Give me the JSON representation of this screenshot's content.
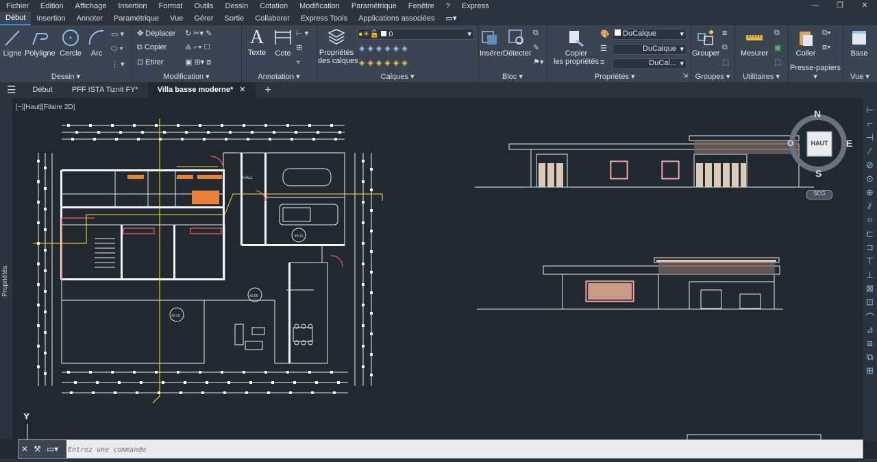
{
  "menu": [
    "Fichier",
    "Edition",
    "Affichage",
    "Insertion",
    "Format",
    "Outils",
    "Dessin",
    "Cotation",
    "Modification",
    "Paramétrique",
    "Fenêtre",
    "?",
    "Express"
  ],
  "ribbon_tabs": [
    {
      "label": "Début",
      "active": true
    },
    {
      "label": "Insertion"
    },
    {
      "label": "Annoter"
    },
    {
      "label": "Paramétrique"
    },
    {
      "label": "Vue"
    },
    {
      "label": "Gérer"
    },
    {
      "label": "Sortie"
    },
    {
      "label": "Collaborer"
    },
    {
      "label": "Express Tools"
    },
    {
      "label": "Applications associées"
    }
  ],
  "panels": {
    "dessin": {
      "title": "Dessin",
      "tools": [
        "Ligne",
        "Polyligne",
        "Cercle",
        "Arc"
      ]
    },
    "modification": {
      "title": "Modification",
      "tools": [
        "Déplacer",
        "Copier",
        "Etirer"
      ]
    },
    "annotation": {
      "title": "Annotation",
      "tools": [
        "Texte",
        "Cote"
      ]
    },
    "calques": {
      "title": "Calques",
      "big": "Propriétés des calques",
      "big_l1": "Propriétés",
      "big_l2": "des calques",
      "layer_value": "0"
    },
    "bloc": {
      "title": "Bloc",
      "tools": [
        "Insérer",
        "Détecter"
      ]
    },
    "proprietes": {
      "title": "Propriétés",
      "copy_l1": "Copier",
      "copy_l2": "les propriétés",
      "color": "DuCalque",
      "linetype": "DuCalque",
      "lineweight": "DuCal..."
    },
    "groupes": {
      "title": "Groupes",
      "tool": "Grouper"
    },
    "utilitaires": {
      "title": "Utilitaires",
      "tool": "Mesurer"
    },
    "presse": {
      "title": "Presse-papiers",
      "tool": "Coller"
    },
    "vue": {
      "title": "Vue",
      "tool": "Base"
    }
  },
  "doc_tabs": [
    {
      "label": "Début"
    },
    {
      "label": "PFF ISTA Tiznit FY*"
    },
    {
      "label": "Villa basse moderne*",
      "active": true
    }
  ],
  "left_palette": "Propriétés",
  "viewport_label": "[−][Haut][Filaire 2D]",
  "viewcube": {
    "face": "HAUT",
    "n": "N",
    "e": "E",
    "s": "S",
    "w": "O",
    "wcs": "SCG"
  },
  "plan_labels": {
    "hall": "HALL",
    "lvl1": "±0.10",
    "lvl2": "±0.00",
    "lvl3": "±0.10"
  },
  "command": {
    "placeholder": "Entrez une commande"
  },
  "colors": {
    "accent": "#2f8fd8",
    "canvas": "#212830",
    "ribbon": "#3b4453",
    "yellow": "#f2e93a",
    "red": "#ff5a5a"
  }
}
